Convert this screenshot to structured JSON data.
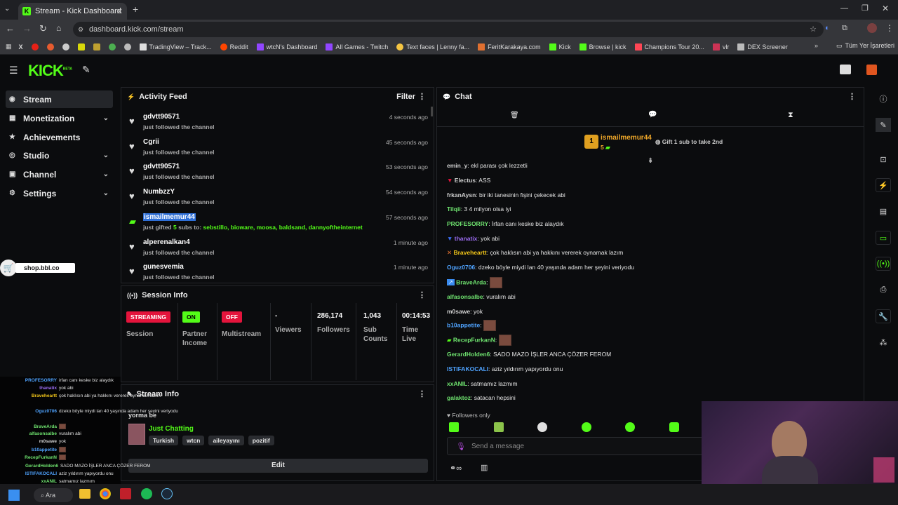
{
  "browser": {
    "tab_title": "Stream - Kick Dashboard",
    "url": "dashboard.kick.com/stream",
    "bookmarks": [
      "X",
      "",
      "",
      "",
      "",
      "TradingView – Track...",
      "Reddit",
      "wtcN's Dashboard",
      "All Games - Twitch",
      "Text faces | Lenny fa...",
      "FeritKarakaya.com",
      "Kick",
      "Browse | kick",
      "Champions Tour 20...",
      "vlr",
      "DEX Screener"
    ],
    "bookmarks_folder": "Tüm Yer İşaretleri"
  },
  "header": {
    "logo": "KICK",
    "beta": "BETA"
  },
  "nav": {
    "items": [
      {
        "label": "Stream",
        "active": true,
        "chevron": false
      },
      {
        "label": "Monetization",
        "active": false,
        "chevron": true
      },
      {
        "label": "Achievements",
        "active": false,
        "chevron": false
      },
      {
        "label": "Studio",
        "active": false,
        "chevron": true
      },
      {
        "label": "Channel",
        "active": false,
        "chevron": true
      },
      {
        "label": "Settings",
        "active": false,
        "chevron": true
      }
    ]
  },
  "promo": {
    "label": "shop.bbl.co"
  },
  "activity": {
    "title": "Activity Feed",
    "filter_label": "Filter",
    "rows": [
      {
        "user": "gdvtt90571",
        "action": "just followed the channel",
        "time": "4 seconds ago",
        "type": "follow"
      },
      {
        "user": "Cgrii",
        "action": "just followed the channel",
        "time": "45 seconds ago",
        "type": "follow"
      },
      {
        "user": "gdvtt90571",
        "action": "just followed the channel",
        "time": "53 seconds ago",
        "type": "follow"
      },
      {
        "user": "NumbzzY",
        "action": "just followed the channel",
        "time": "54 seconds ago",
        "type": "follow"
      },
      {
        "user": "ismailmemur44",
        "action_prefix": "just gifted",
        "action_count": "5",
        "action_mid": "subs to:",
        "action_targets": "sebstillo, bioware, moosa, baldsand, dannyoftheinternet",
        "time": "57 seconds ago",
        "type": "gift"
      },
      {
        "user": "alperenalkan4",
        "action": "just followed the channel",
        "time": "1 minute ago",
        "type": "follow"
      },
      {
        "user": "gunesvemia",
        "action": "just followed the channel",
        "time": "1 minute ago",
        "type": "follow"
      }
    ]
  },
  "session": {
    "title": "Session Info",
    "cols": [
      {
        "badge": "STREAMING",
        "label": "Session"
      },
      {
        "badge": "ON",
        "label": "Partner Income"
      },
      {
        "badge": "OFF",
        "label": "Multistream"
      },
      {
        "value": "-",
        "label": "Viewers"
      },
      {
        "value": "286,174",
        "label": "Followers"
      },
      {
        "value": "1,043",
        "label": "Sub Counts"
      },
      {
        "value": "00:14:53",
        "label": "Time Live"
      }
    ]
  },
  "stream_info": {
    "title": "Stream Info",
    "stream_title": "yorma be",
    "category": "Just Chatting",
    "tags": [
      "Turkish",
      "wtcn",
      "aileyayını",
      "pozitif"
    ],
    "edit_label": "Edit"
  },
  "chat": {
    "title": "Chat",
    "pinned_user": "ismailmemur44",
    "pinned_count": "5",
    "gift_prompt": "Gift 1 sub to take 2nd",
    "lines": [
      {
        "user": "emin_y",
        "color": "#cfcfcf",
        "text": ": ekl parası çok lezzetli",
        "badge": ""
      },
      {
        "user": "Electus",
        "color": "#cfcfcf",
        "text": ": ASS",
        "badge": "red"
      },
      {
        "user": "frkanAysn",
        "color": "#cfcfcf",
        "text": ": bir iki tanesinin fişini çekecek abi",
        "badge": ""
      },
      {
        "user": "Tilqii",
        "color": "#6fe36f",
        "text": ": 3 4 milyon olsa iyi",
        "badge": ""
      },
      {
        "user": "PROFESORRY",
        "color": "#6fe36f",
        "text": ": İrfan canı keske biz alaydık",
        "badge": ""
      },
      {
        "user": "thanatix",
        "color": "#9b6cf0",
        "text": ": yok abi",
        "badge": "blue"
      },
      {
        "user": "Braveheartt",
        "color": "#f0c419",
        "text": ": çok haklısın abi ya hakkını vererek oynamak lazım",
        "badge": "red"
      },
      {
        "user": "Oguz0706",
        "color": "#4fa3ff",
        "text": ": dzeko böyle miydi lan 40 yaşında adam her şeyini veriyodu",
        "badge": ""
      },
      {
        "user": "BraveArda",
        "color": "#6fe36f",
        "text": ":",
        "badge": "blue",
        "emote": true
      },
      {
        "user": "alfasonsalbe",
        "color": "#6fe36f",
        "text": ": vuralım abi",
        "badge": ""
      },
      {
        "user": "m0sawe",
        "color": "#cfcfcf",
        "text": ": yok",
        "badge": ""
      },
      {
        "user": "b10appetite",
        "color": "#4fa3ff",
        "text": ":",
        "badge": "",
        "emote": true
      },
      {
        "user": "RecepFurkanN",
        "color": "#6fe36f",
        "text": ":",
        "badge": "green",
        "emote": true
      },
      {
        "user": "GerardHolden6",
        "color": "#6fe36f",
        "text": ": SADO MAZO İŞLER ANCA ÇÖZER FEROM",
        "badge": ""
      },
      {
        "user": "ISTIFAKOCALI",
        "color": "#4fa3ff",
        "text": ": aziz yıldırım yapıyordu onu",
        "badge": ""
      },
      {
        "user": "xxANIL",
        "color": "#6fe36f",
        "text": ": satmamız lazmım",
        "badge": ""
      },
      {
        "user": "galaktoz",
        "color": "#6fe36f",
        "text": ": satacan hepsini",
        "badge": ""
      }
    ],
    "followers_only": "Followers only",
    "placeholder": "Send a message"
  },
  "overlay_chat": [
    {
      "user": "PROFESORRY",
      "text": "irfan canı keske biz alaydık"
    },
    {
      "user": "thanatix",
      "text": "yok abi"
    },
    {
      "user": "Braveheartt",
      "text": "çok haklısın abi ya hakkını vererek oynamak lazım"
    },
    {
      "user": "Oguz0706",
      "text": "dzeko böyle miydi lan 40 yaşında adam her şeyini veriyodu"
    },
    {
      "user": "BraveArda",
      "text": ""
    },
    {
      "user": "alfasonsalbe",
      "text": "vuralım abi"
    },
    {
      "user": "m0sawe",
      "text": "yok"
    },
    {
      "user": "b10appetite",
      "text": ""
    },
    {
      "user": "RecepFurkanN",
      "text": ""
    },
    {
      "user": "GerardHolden6",
      "text": "SADO MAZO İŞLER ANCA ÇÖZER FEROM"
    },
    {
      "user": "ISTIFAKOCALI",
      "text": "aziz yıldırım yapıyordu onu"
    },
    {
      "user": "xxANIL",
      "text": "satmamız lazmım"
    }
  ],
  "taskbar": {
    "search_label": "Ara"
  },
  "colors": {
    "accent": "#53fc18",
    "red": "#e4143c",
    "bg": "#0b0c0e"
  }
}
